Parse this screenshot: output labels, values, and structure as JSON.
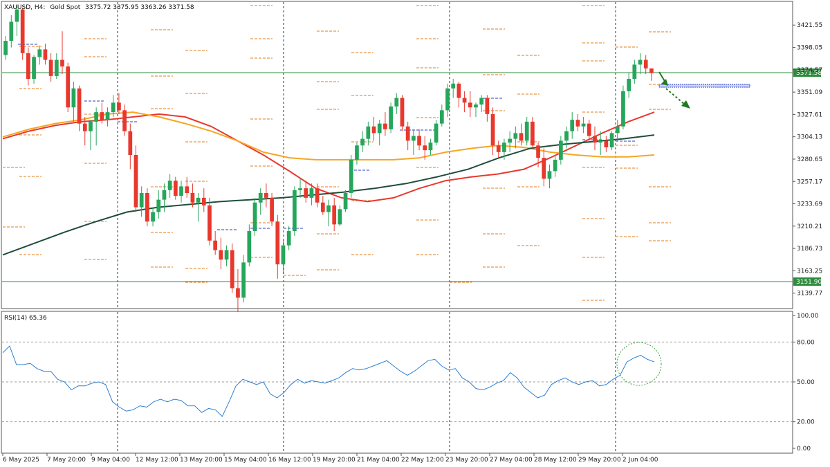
{
  "header": {
    "symbol": "XAUUSD, H4:",
    "description": "Gold Spot",
    "ohlc": "3375.72 3375.95 3363.26 3371.58"
  },
  "colors": {
    "bull": "#26a65b",
    "bear": "#e8382d",
    "ma_fast": "#e8382d",
    "ma_mid": "#f5a623",
    "ma_slow": "#1f4d3a",
    "rsi": "#2b7fd3",
    "level": "#2e8b3e",
    "pivot": "#e07b1a",
    "pivot_blue": "#2a3fbf",
    "arrow": "#1f7a1f"
  },
  "chart_data": [
    {
      "type": "line",
      "title": "XAUUSD, H4: Gold Spot",
      "ylim": [
        3125,
        3445
      ],
      "y_ticks": [
        "3421.55",
        "3398.05",
        "3374.57",
        "3351.09",
        "3327.61",
        "3304.13",
        "3280.65",
        "3257.17",
        "3233.69",
        "3210.21",
        "3186.73",
        "3163.25",
        "3139.77"
      ],
      "x_labels": [
        "6 May 2025",
        "7 May 20:00",
        "9 May 04:00",
        "12 May 12:00",
        "13 May 20:00",
        "15 May 04:00",
        "16 May 12:00",
        "19 May 20:00",
        "21 May 04:00",
        "22 May 12:00",
        "23 May 20:00",
        "27 May 04:00",
        "28 May 12:00",
        "29 May 20:00",
        "2 Jun 04:00"
      ],
      "candles_ohlc": [
        [
          3390,
          3410,
          3385,
          3405
        ],
        [
          3405,
          3432,
          3398,
          3425
        ],
        [
          3425,
          3442,
          3410,
          3438
        ],
        [
          3438,
          3440,
          3385,
          3392
        ],
        [
          3392,
          3398,
          3358,
          3365
        ],
        [
          3365,
          3390,
          3360,
          3388
        ],
        [
          3388,
          3400,
          3380,
          3396
        ],
        [
          3396,
          3402,
          3380,
          3385
        ],
        [
          3385,
          3392,
          3362,
          3368
        ],
        [
          3368,
          3392,
          3365,
          3385
        ],
        [
          3385,
          3415,
          3370,
          3378
        ],
        [
          3378,
          3382,
          3330,
          3335
        ],
        [
          3335,
          3362,
          3320,
          3355
        ],
        [
          3355,
          3358,
          3310,
          3318
        ],
        [
          3318,
          3325,
          3295,
          3310
        ],
        [
          3310,
          3322,
          3290,
          3320
        ],
        [
          3320,
          3335,
          3295,
          3330
        ],
        [
          3330,
          3340,
          3318,
          3322
        ],
        [
          3322,
          3335,
          3315,
          3330
        ],
        [
          3330,
          3348,
          3325,
          3340
        ],
        [
          3340,
          3350,
          3328,
          3332
        ],
        [
          3332,
          3338,
          3305,
          3310
        ],
        [
          3310,
          3318,
          3270,
          3285
        ],
        [
          3285,
          3295,
          3225,
          3230
        ],
        [
          3230,
          3252,
          3220,
          3245
        ],
        [
          3245,
          3250,
          3210,
          3215
        ],
        [
          3215,
          3230,
          3210,
          3225
        ],
        [
          3225,
          3248,
          3218,
          3238
        ],
        [
          3238,
          3255,
          3225,
          3248
        ],
        [
          3248,
          3265,
          3240,
          3258
        ],
        [
          3258,
          3262,
          3238,
          3242
        ],
        [
          3242,
          3258,
          3235,
          3252
        ],
        [
          3252,
          3262,
          3240,
          3245
        ],
        [
          3245,
          3255,
          3230,
          3235
        ],
        [
          3235,
          3245,
          3215,
          3240
        ],
        [
          3240,
          3250,
          3225,
          3232
        ],
        [
          3232,
          3240,
          3190,
          3195
        ],
        [
          3195,
          3205,
          3180,
          3185
        ],
        [
          3185,
          3198,
          3165,
          3175
        ],
        [
          3175,
          3190,
          3168,
          3185
        ],
        [
          3185,
          3192,
          3140,
          3145
        ],
        [
          3145,
          3165,
          3120,
          3135
        ],
        [
          3135,
          3180,
          3130,
          3172
        ],
        [
          3172,
          3212,
          3168,
          3205
        ],
        [
          3205,
          3240,
          3200,
          3235
        ],
        [
          3235,
          3250,
          3222,
          3245
        ],
        [
          3245,
          3255,
          3230,
          3240
        ],
        [
          3240,
          3245,
          3210,
          3215
        ],
        [
          3215,
          3222,
          3155,
          3170
        ],
        [
          3170,
          3195,
          3160,
          3190
        ],
        [
          3190,
          3210,
          3185,
          3205
        ],
        [
          3205,
          3252,
          3200,
          3248
        ],
        [
          3248,
          3260,
          3240,
          3250
        ],
        [
          3250,
          3258,
          3235,
          3240
        ],
        [
          3240,
          3255,
          3232,
          3250
        ],
        [
          3250,
          3255,
          3230,
          3235
        ],
        [
          3235,
          3242,
          3222,
          3225
        ],
        [
          3225,
          3238,
          3210,
          3232
        ],
        [
          3232,
          3240,
          3205,
          3212
        ],
        [
          3212,
          3232,
          3210,
          3228
        ],
        [
          3228,
          3248,
          3225,
          3245
        ],
        [
          3245,
          3285,
          3240,
          3280
        ],
        [
          3280,
          3298,
          3275,
          3295
        ],
        [
          3295,
          3310,
          3288,
          3302
        ],
        [
          3302,
          3320,
          3295,
          3315
        ],
        [
          3315,
          3325,
          3300,
          3308
        ],
        [
          3308,
          3322,
          3295,
          3318
        ],
        [
          3318,
          3330,
          3305,
          3312
        ],
        [
          3312,
          3340,
          3308,
          3336
        ],
        [
          3336,
          3350,
          3328,
          3345
        ],
        [
          3345,
          3348,
          3310,
          3315
        ],
        [
          3315,
          3320,
          3290,
          3300
        ],
        [
          3300,
          3312,
          3285,
          3305
        ],
        [
          3305,
          3312,
          3290,
          3295
        ],
        [
          3295,
          3305,
          3280,
          3290
        ],
        [
          3290,
          3302,
          3285,
          3298
        ],
        [
          3298,
          3322,
          3295,
          3318
        ],
        [
          3318,
          3338,
          3315,
          3332
        ],
        [
          3332,
          3360,
          3325,
          3355
        ],
        [
          3355,
          3365,
          3345,
          3360
        ],
        [
          3360,
          3362,
          3335,
          3345
        ],
        [
          3345,
          3352,
          3330,
          3340
        ],
        [
          3340,
          3352,
          3325,
          3335
        ],
        [
          3335,
          3340,
          3325,
          3338
        ],
        [
          3338,
          3348,
          3330,
          3345
        ],
        [
          3345,
          3348,
          3320,
          3328
        ],
        [
          3328,
          3335,
          3285,
          3295
        ],
        [
          3295,
          3300,
          3282,
          3288
        ],
        [
          3288,
          3302,
          3280,
          3298
        ],
        [
          3298,
          3310,
          3288,
          3302
        ],
        [
          3302,
          3315,
          3292,
          3308
        ],
        [
          3308,
          3318,
          3295,
          3300
        ],
        [
          3300,
          3325,
          3295,
          3320
        ],
        [
          3320,
          3325,
          3292,
          3295
        ],
        [
          3295,
          3298,
          3272,
          3282
        ],
        [
          3282,
          3292,
          3252,
          3260
        ],
        [
          3260,
          3275,
          3250,
          3268
        ],
        [
          3268,
          3285,
          3262,
          3280
        ],
        [
          3280,
          3305,
          3275,
          3300
        ],
        [
          3300,
          3315,
          3292,
          3310
        ],
        [
          3310,
          3330,
          3302,
          3322
        ],
        [
          3322,
          3328,
          3310,
          3315
        ],
        [
          3315,
          3325,
          3308,
          3318
        ],
        [
          3318,
          3322,
          3300,
          3305
        ],
        [
          3305,
          3315,
          3290,
          3298
        ],
        [
          3298,
          3310,
          3285,
          3300
        ],
        [
          3300,
          3305,
          3288,
          3293
        ],
        [
          3293,
          3310,
          3290,
          3308
        ],
        [
          3308,
          3322,
          3300,
          3315
        ],
        [
          3315,
          3358,
          3312,
          3352
        ],
        [
          3352,
          3372,
          3345,
          3365
        ],
        [
          3365,
          3385,
          3360,
          3380
        ],
        [
          3380,
          3392,
          3370,
          3385
        ],
        [
          3385,
          3390,
          3370,
          3376
        ],
        [
          3376,
          3376,
          3363,
          3371
        ]
      ],
      "series": [
        {
          "name": "MA fast",
          "values": [
            3302,
            3310,
            3316,
            3320,
            3322,
            3325,
            3328,
            3325,
            3315,
            3300,
            3285,
            3268,
            3250,
            3240,
            3236,
            3240,
            3250,
            3258,
            3262,
            3265,
            3270,
            3282,
            3295,
            3308,
            3320,
            3330
          ]
        },
        {
          "name": "MA mid",
          "values": [
            3304,
            3312,
            3318,
            3322,
            3328,
            3330,
            3325,
            3318,
            3310,
            3300,
            3288,
            3282,
            3280,
            3280,
            3280,
            3280,
            3282,
            3288,
            3292,
            3295,
            3293,
            3288,
            3285,
            3283,
            3283,
            3285
          ]
        },
        {
          "name": "MA slow",
          "values": [
            3180,
            3192,
            3204,
            3215,
            3225,
            3230,
            3233,
            3236,
            3238,
            3240,
            3243,
            3246,
            3250,
            3255,
            3262,
            3270,
            3282,
            3292,
            3296,
            3299,
            3302,
            3306
          ]
        }
      ],
      "levels": [
        {
          "label": "3371.58",
          "value": 3371.58
        },
        {
          "label": "3151.90",
          "value": 3151.9
        }
      ]
    },
    {
      "type": "line",
      "title": "RSI(14) 65.36",
      "ylim": [
        0,
        100
      ],
      "y_ticks": [
        "100.00",
        "80.00",
        "50.00",
        "20.00",
        "0.00"
      ],
      "series": [
        {
          "name": "RSI(14)",
          "values": [
            72,
            77,
            63,
            63,
            64,
            60,
            58,
            58,
            52,
            50,
            44,
            47,
            47,
            49,
            50,
            48,
            35,
            31,
            28,
            29,
            32,
            31,
            35,
            37,
            35,
            37,
            36,
            32,
            32,
            27,
            30,
            29,
            24,
            35,
            47,
            52,
            50,
            48,
            50,
            41,
            38,
            42,
            48,
            52,
            49,
            51,
            50,
            49,
            51,
            53,
            57,
            60,
            59,
            60,
            62,
            64,
            66,
            62,
            58,
            55,
            58,
            62,
            66,
            67,
            62,
            59,
            60,
            53,
            50,
            45,
            44,
            46,
            49,
            51,
            57,
            53,
            46,
            42,
            38,
            40,
            48,
            51,
            53,
            50,
            48,
            50,
            51,
            47,
            48,
            52,
            55,
            65,
            68,
            70,
            67,
            65
          ]
        }
      ]
    }
  ]
}
